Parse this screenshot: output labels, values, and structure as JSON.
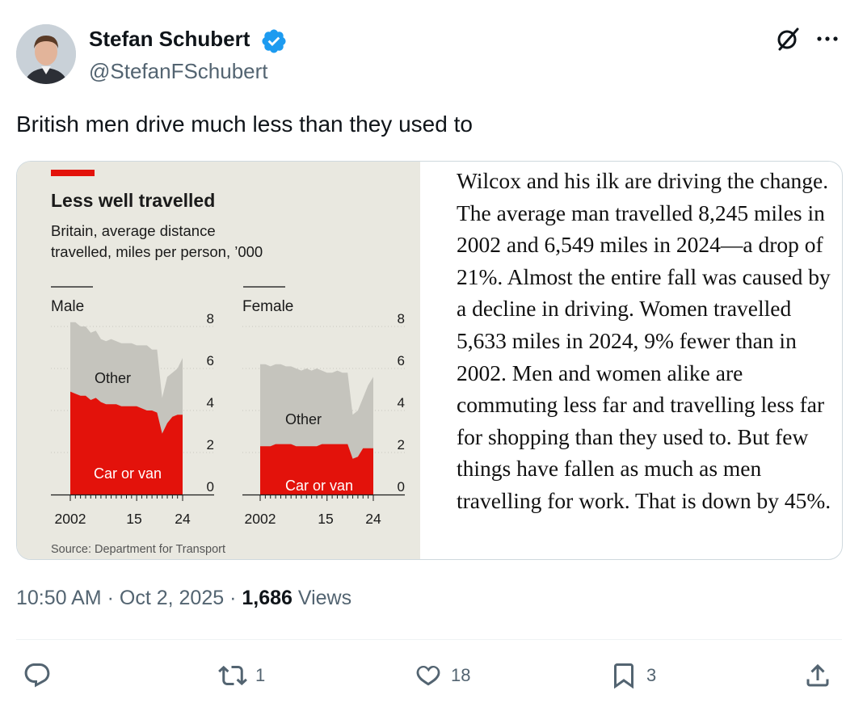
{
  "author": {
    "name": "Stefan Schubert",
    "handle": "@StefanFSchubert",
    "verified_color": "#1d9bf0"
  },
  "tweet": {
    "text": "British men drive much less than they used to",
    "time": "10:50 AM",
    "date": "Oct 2, 2025",
    "views_count": "1,686",
    "views_label": "Views"
  },
  "actions": {
    "replies": "",
    "retweets": "1",
    "likes": "18",
    "bookmarks": "3",
    "icons": [
      "reply-icon",
      "retweet-icon",
      "like-icon",
      "bookmark-icon",
      "share-icon"
    ]
  },
  "article": {
    "text": "Wilcox and his ilk are driving the change. The average man travelled 8,245 miles in 2002 and 6,549 miles in 2024—a drop of 21%. Almost the entire fall was caused by a decline in driving. Women travelled 5,633 miles in 2024, 9% fewer than in 2002. Men and women alike are commuting less far and travelling less far for shopping than they used to. But few things have fallen as much as men travelling for work. That is down by 45%."
  },
  "chart_data": {
    "type": "area",
    "title": "Less well travelled",
    "subtitle_line1": "Britain, average distance",
    "subtitle_line2": "travelled, miles per person, ’000",
    "source": "Source: Department for Transport",
    "accent_color": "#e3120b",
    "car_color": "#e3120b",
    "other_color": "#c5c4bd",
    "ylim": [
      0,
      8
    ],
    "yticks": [
      "8",
      "6",
      "4",
      "2",
      "0"
    ],
    "xticks": [
      "2002",
      "15",
      "24"
    ],
    "panels": [
      {
        "label": "Male",
        "series_labels": [
          "Other",
          "Car or van"
        ],
        "years": [
          2002,
          2003,
          2004,
          2005,
          2006,
          2007,
          2008,
          2009,
          2010,
          2011,
          2012,
          2013,
          2014,
          2015,
          2016,
          2017,
          2018,
          2019,
          2020,
          2021,
          2022,
          2023,
          2024
        ],
        "car": [
          4.9,
          4.8,
          4.7,
          4.7,
          4.5,
          4.6,
          4.4,
          4.3,
          4.3,
          4.3,
          4.2,
          4.2,
          4.2,
          4.2,
          4.1,
          4.0,
          4.0,
          3.9,
          2.9,
          3.4,
          3.7,
          3.8,
          3.8
        ],
        "total": [
          8.2,
          8.2,
          8.0,
          8.0,
          7.7,
          7.8,
          7.4,
          7.3,
          7.4,
          7.3,
          7.2,
          7.2,
          7.2,
          7.1,
          7.1,
          7.1,
          6.9,
          6.9,
          4.6,
          5.6,
          5.8,
          6.0,
          6.5
        ]
      },
      {
        "label": "Female",
        "series_labels": [
          "Other",
          "Car or van"
        ],
        "years": [
          2002,
          2003,
          2004,
          2005,
          2006,
          2007,
          2008,
          2009,
          2010,
          2011,
          2012,
          2013,
          2014,
          2015,
          2016,
          2017,
          2018,
          2019,
          2020,
          2021,
          2022,
          2023,
          2024
        ],
        "car": [
          2.3,
          2.3,
          2.3,
          2.4,
          2.4,
          2.4,
          2.4,
          2.3,
          2.3,
          2.3,
          2.3,
          2.3,
          2.4,
          2.4,
          2.4,
          2.4,
          2.4,
          2.4,
          1.7,
          1.8,
          2.2,
          2.2,
          2.2
        ],
        "total": [
          6.2,
          6.2,
          6.1,
          6.2,
          6.2,
          6.1,
          6.1,
          6.0,
          5.9,
          6.0,
          5.9,
          6.0,
          5.9,
          5.8,
          5.8,
          5.9,
          5.8,
          5.8,
          3.8,
          4.0,
          4.6,
          5.2,
          5.6
        ]
      }
    ]
  }
}
